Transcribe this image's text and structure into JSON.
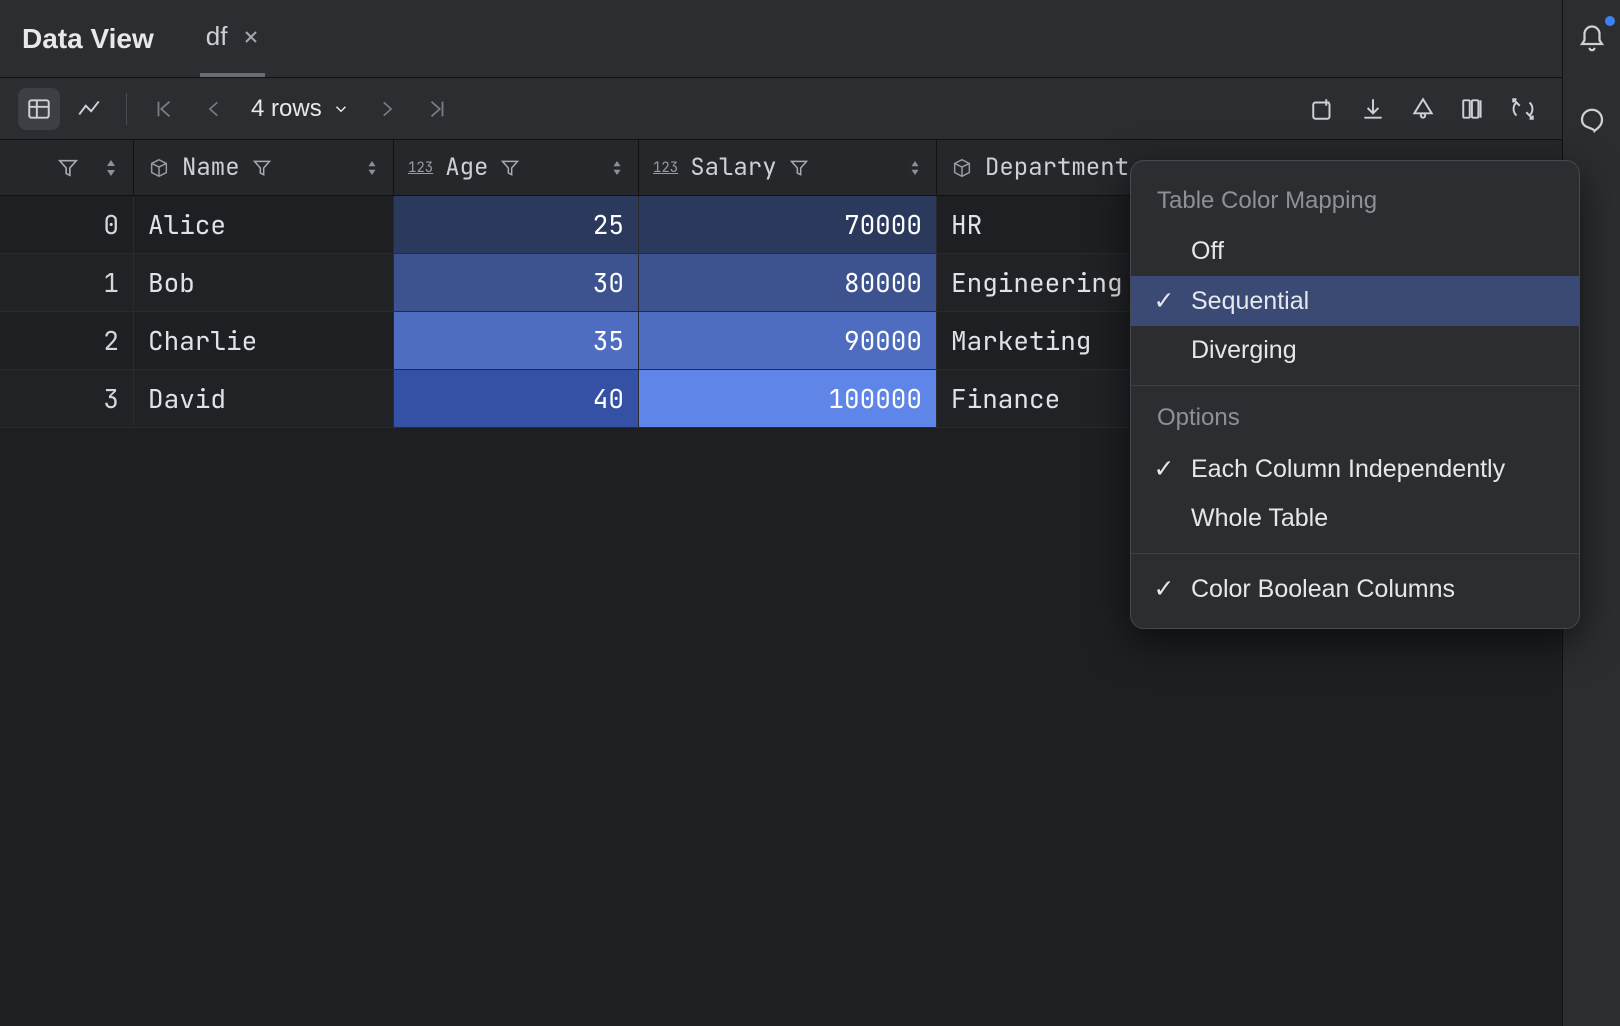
{
  "panel": {
    "title": "Data View"
  },
  "tab": {
    "label": "df"
  },
  "toolbar": {
    "row_count": "4 rows"
  },
  "columns": {
    "name": {
      "label": "Name"
    },
    "age": {
      "label": "Age"
    },
    "salary": {
      "label": "Salary"
    },
    "dept": {
      "label": "Department"
    }
  },
  "rows": [
    {
      "idx": "0",
      "name": "Alice",
      "age": "25",
      "salary": "70000",
      "dept": "HR",
      "age_bg": "#2b3a5c",
      "sal_bg": "#2b3a5c"
    },
    {
      "idx": "1",
      "name": "Bob",
      "age": "30",
      "salary": "80000",
      "dept": "Engineering",
      "age_bg": "#3d5390",
      "sal_bg": "#3d5390"
    },
    {
      "idx": "2",
      "name": "Charlie",
      "age": "35",
      "salary": "90000",
      "dept": "Marketing",
      "age_bg": "#4e6cc0",
      "sal_bg": "#4e6cc0"
    },
    {
      "idx": "3",
      "name": "David",
      "age": "40",
      "salary": "100000",
      "dept": "Finance",
      "age_bg": "#3551a6",
      "sal_bg": "#5f85e8"
    }
  ],
  "popup": {
    "title": "Table Color Mapping",
    "modes": {
      "off": "Off",
      "sequential": "Sequential",
      "diverging": "Diverging"
    },
    "options_title": "Options",
    "options": {
      "each_col": "Each Column Independently",
      "whole_table": "Whole Table"
    },
    "bool": "Color Boolean Columns"
  }
}
